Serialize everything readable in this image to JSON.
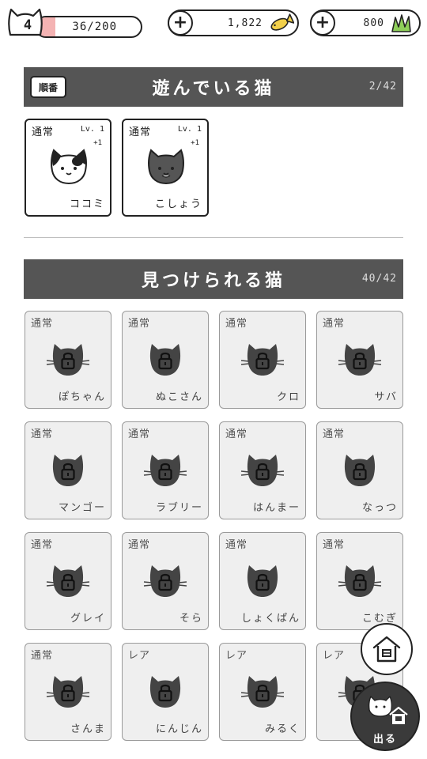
{
  "player": {
    "level": "4",
    "xp_text": "36/200",
    "xp_progress": 0.18
  },
  "currency": {
    "fish": {
      "value": "1,822",
      "icon": "fish-icon",
      "add_icon": "plus-icon"
    },
    "grass": {
      "value": "800",
      "icon": "grass-icon",
      "add_icon": "plus-icon"
    }
  },
  "playing_section": {
    "sort_label": "順番",
    "title": "遊んでいる猫",
    "count": "2/42",
    "cats": [
      {
        "rarity": "通常",
        "level": "Lv. 1",
        "bonus": "+1",
        "name": "ココミ",
        "pattern": "calico"
      },
      {
        "rarity": "通常",
        "level": "Lv. 1",
        "bonus": "+1",
        "name": "こしょう",
        "pattern": "gray"
      }
    ]
  },
  "discoverable_section": {
    "title": "見つけられる猫",
    "count": "40/42",
    "cats": [
      {
        "rarity": "通常",
        "name": "ぽちゃん"
      },
      {
        "rarity": "通常",
        "name": "ぬこさん"
      },
      {
        "rarity": "通常",
        "name": "クロ"
      },
      {
        "rarity": "通常",
        "name": "サバ"
      },
      {
        "rarity": "通常",
        "name": "マンゴー"
      },
      {
        "rarity": "通常",
        "name": "ラブリー"
      },
      {
        "rarity": "通常",
        "name": "はんまー"
      },
      {
        "rarity": "通常",
        "name": "なっつ"
      },
      {
        "rarity": "通常",
        "name": "グレイ"
      },
      {
        "rarity": "通常",
        "name": "そら"
      },
      {
        "rarity": "通常",
        "name": "しょくぱん"
      },
      {
        "rarity": "通常",
        "name": "こむぎ"
      },
      {
        "rarity": "通常",
        "name": "さんま"
      },
      {
        "rarity": "レア",
        "name": "にんじん"
      },
      {
        "rarity": "レア",
        "name": "みるく"
      },
      {
        "rarity": "レア",
        "name": ""
      }
    ]
  },
  "buttons": {
    "home_icon": "house-icon",
    "exit_label": "出る"
  },
  "colors": {
    "header_bg": "#555555",
    "xp_fill": "#f4b3b3",
    "fish": "#f2d04a",
    "grass": "#8fcf5a",
    "locked_card_bg": "#efefef",
    "silhouette": "#444444"
  }
}
